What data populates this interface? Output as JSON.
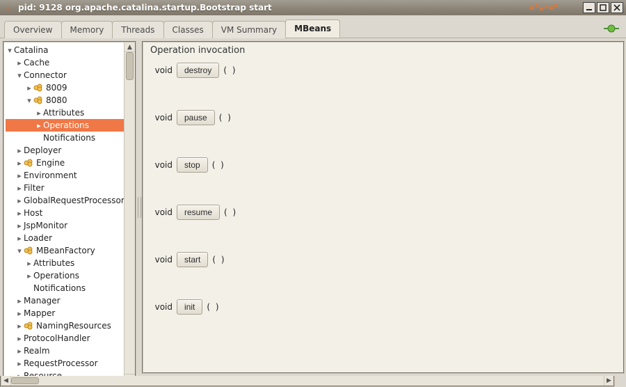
{
  "window": {
    "title": "pid: 9128 org.apache.catalina.startup.Bootstrap start"
  },
  "tabs": [
    {
      "label": "Overview",
      "active": false
    },
    {
      "label": "Memory",
      "active": false
    },
    {
      "label": "Threads",
      "active": false
    },
    {
      "label": "Classes",
      "active": false
    },
    {
      "label": "VM Summary",
      "active": false
    },
    {
      "label": "MBeans",
      "active": true
    }
  ],
  "tree": [
    {
      "depth": 0,
      "toggle": "▾",
      "icon": "none",
      "label": "Catalina"
    },
    {
      "depth": 1,
      "toggle": "▸",
      "icon": "none",
      "label": "Cache"
    },
    {
      "depth": 1,
      "toggle": "▾",
      "icon": "none",
      "label": "Connector"
    },
    {
      "depth": 2,
      "toggle": "▸",
      "icon": "bean",
      "label": "8009"
    },
    {
      "depth": 2,
      "toggle": "▾",
      "icon": "bean",
      "label": "8080"
    },
    {
      "depth": 3,
      "toggle": "▸",
      "icon": "none",
      "label": "Attributes"
    },
    {
      "depth": 3,
      "toggle": "▸",
      "icon": "none",
      "label": "Operations",
      "selected": true
    },
    {
      "depth": 3,
      "toggle": "",
      "icon": "none",
      "label": "Notifications"
    },
    {
      "depth": 1,
      "toggle": "▸",
      "icon": "none",
      "label": "Deployer"
    },
    {
      "depth": 1,
      "toggle": "▸",
      "icon": "bean",
      "label": "Engine"
    },
    {
      "depth": 1,
      "toggle": "▸",
      "icon": "none",
      "label": "Environment"
    },
    {
      "depth": 1,
      "toggle": "▸",
      "icon": "none",
      "label": "Filter"
    },
    {
      "depth": 1,
      "toggle": "▸",
      "icon": "none",
      "label": "GlobalRequestProcessor"
    },
    {
      "depth": 1,
      "toggle": "▸",
      "icon": "none",
      "label": "Host"
    },
    {
      "depth": 1,
      "toggle": "▸",
      "icon": "none",
      "label": "JspMonitor"
    },
    {
      "depth": 1,
      "toggle": "▸",
      "icon": "none",
      "label": "Loader"
    },
    {
      "depth": 1,
      "toggle": "▾",
      "icon": "bean",
      "label": "MBeanFactory"
    },
    {
      "depth": 2,
      "toggle": "▸",
      "icon": "none",
      "label": "Attributes"
    },
    {
      "depth": 2,
      "toggle": "▸",
      "icon": "none",
      "label": "Operations"
    },
    {
      "depth": 2,
      "toggle": "",
      "icon": "none",
      "label": "Notifications"
    },
    {
      "depth": 1,
      "toggle": "▸",
      "icon": "none",
      "label": "Manager"
    },
    {
      "depth": 1,
      "toggle": "▸",
      "icon": "none",
      "label": "Mapper"
    },
    {
      "depth": 1,
      "toggle": "▸",
      "icon": "bean",
      "label": "NamingResources"
    },
    {
      "depth": 1,
      "toggle": "▸",
      "icon": "none",
      "label": "ProtocolHandler"
    },
    {
      "depth": 1,
      "toggle": "▸",
      "icon": "none",
      "label": "Realm"
    },
    {
      "depth": 1,
      "toggle": "▸",
      "icon": "none",
      "label": "RequestProcessor"
    },
    {
      "depth": 1,
      "toggle": "▸",
      "icon": "none",
      "label": "Resource"
    }
  ],
  "panel": {
    "title": "Operation invocation",
    "operations": [
      {
        "returnType": "void",
        "name": "destroy",
        "params": "( )"
      },
      {
        "returnType": "void",
        "name": "pause",
        "params": "( )"
      },
      {
        "returnType": "void",
        "name": "stop",
        "params": "( )"
      },
      {
        "returnType": "void",
        "name": "resume",
        "params": "( )"
      },
      {
        "returnType": "void",
        "name": "start",
        "params": "( )"
      },
      {
        "returnType": "void",
        "name": "init",
        "params": "( )"
      }
    ]
  }
}
